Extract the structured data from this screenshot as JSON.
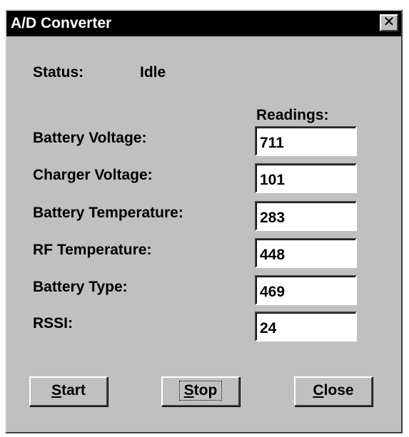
{
  "window": {
    "title": "A/D Converter",
    "close_glyph": "✕"
  },
  "status": {
    "label": "Status:",
    "value": "Idle"
  },
  "readings": {
    "header": "Readings:",
    "rows": [
      {
        "label": "Battery Voltage:",
        "value": "711"
      },
      {
        "label": "Charger Voltage:",
        "value": "101"
      },
      {
        "label": "Battery Temperature:",
        "value": "283"
      },
      {
        "label": "RF Temperature:",
        "value": "448"
      },
      {
        "label": "Battery Type:",
        "value": "469"
      },
      {
        "label": "RSSI:",
        "value": "24"
      }
    ]
  },
  "buttons": {
    "start": {
      "mnemonic": "S",
      "rest": "tart"
    },
    "stop": {
      "mnemonic": "S",
      "rest": "top"
    },
    "close": {
      "mnemonic": "C",
      "rest": "lose"
    }
  }
}
